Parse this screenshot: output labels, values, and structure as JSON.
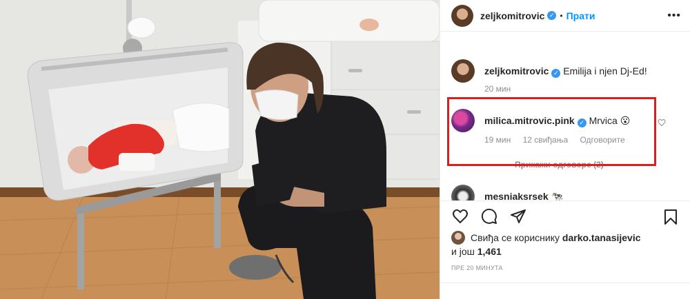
{
  "header": {
    "username": "zeljkomitrovic",
    "verified_glyph": "✓",
    "separator": "•",
    "follow_label": "Прати",
    "more_label": "•••"
  },
  "comments": [
    {
      "username": "zeljkomitrovic",
      "text": "Emilija i njen Dj-Ed!",
      "time": "20 мин"
    },
    {
      "username": "milica.mitrovic.pink",
      "text": "Mrvica",
      "emoji": "😮",
      "time": "19 мин",
      "likes": "12 свиђања",
      "reply_label": "Одговорите",
      "view_replies": "Прикажи одговоре (2)"
    },
    {
      "username": "mesniaksrsek",
      "emoji": "🐄"
    }
  ],
  "actions": {
    "like": "heart-outline-icon",
    "comment": "comment-bubble-icon",
    "share": "paper-plane-icon",
    "save": "bookmark-icon"
  },
  "likes": {
    "prefix": "Свиђа се кориснику",
    "user": "darko.tanasijevic",
    "and_more": "и још",
    "count": "1,461"
  },
  "timestamp": "ПРЕ 20 МИНУТА",
  "colors": {
    "highlight": "#d81e1e",
    "link": "#0095f6",
    "verified": "#3897f0"
  }
}
